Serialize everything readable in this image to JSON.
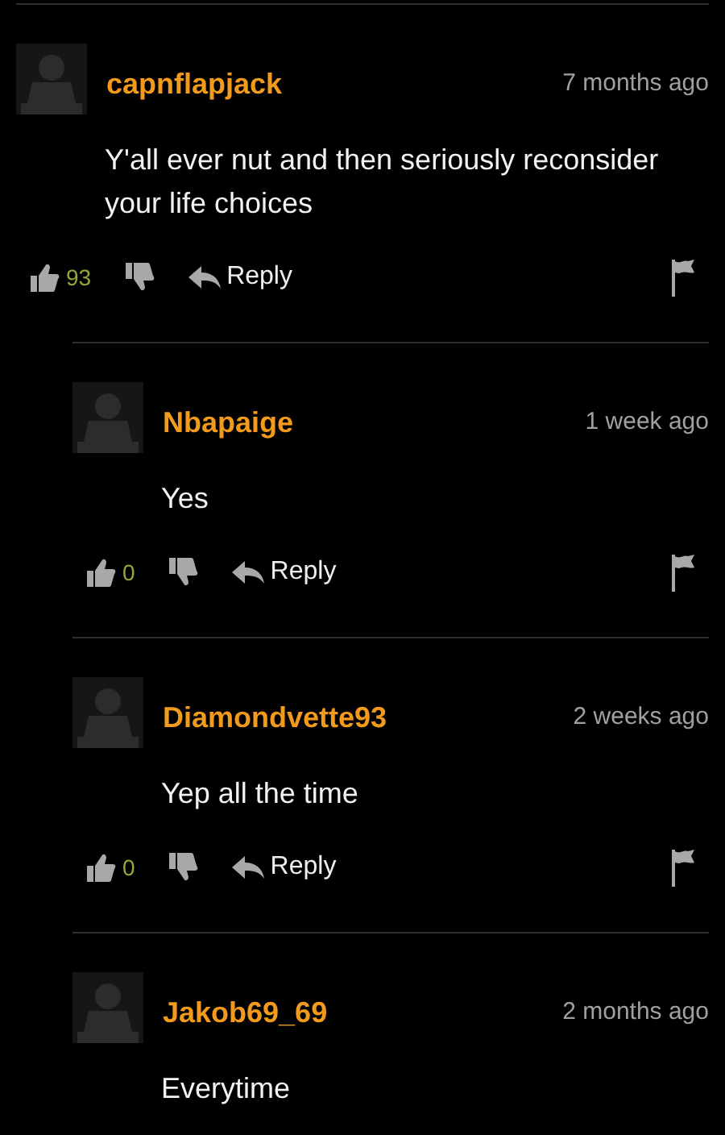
{
  "comments": [
    {
      "user": "capnflapjack",
      "time": "7 months ago",
      "text": "Y'all ever nut and then seriously reconsider your life choices",
      "actions": {
        "likes": "93",
        "reply": "Reply"
      },
      "replies": [
        {
          "user": "Nbapaige",
          "time": "1 week ago",
          "text": "Yes",
          "actions": {
            "likes": "0",
            "reply": "Reply"
          }
        },
        {
          "user": "Diamondvette93",
          "time": "2 weeks ago",
          "text": "Yep all the time",
          "actions": {
            "likes": "0",
            "reply": "Reply"
          }
        },
        {
          "user": "Jakob69_69",
          "time": "2 months ago",
          "text": "Everytime"
        }
      ]
    }
  ]
}
